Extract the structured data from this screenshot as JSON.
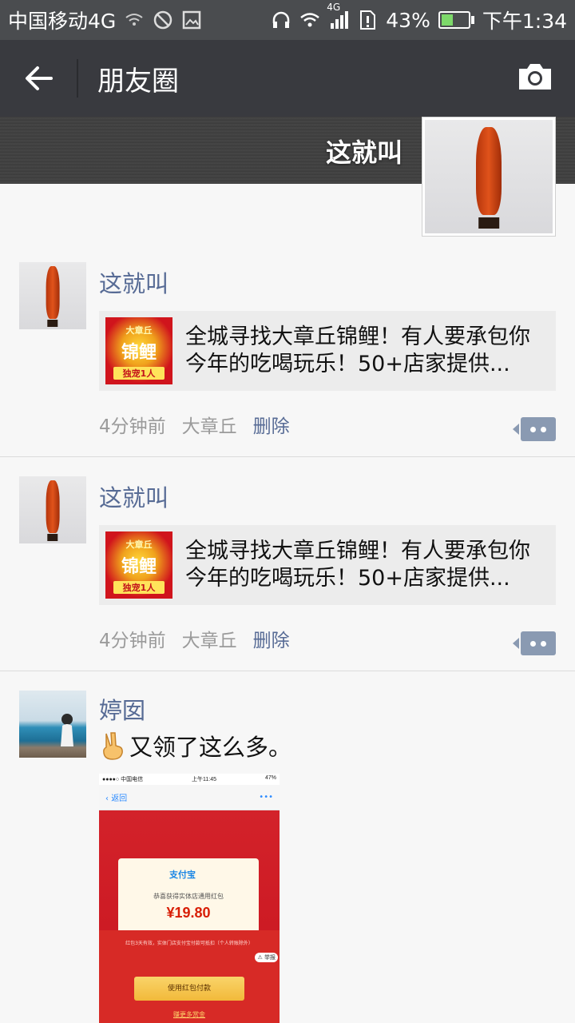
{
  "status_bar": {
    "carrier": "中国移动4G",
    "network_badge": "4G",
    "battery": "43%",
    "battery_level": 0.43,
    "time": "下午1:34"
  },
  "header": {
    "back_icon": "arrow-left-icon",
    "title": "朋友圈",
    "camera_icon": "camera-icon"
  },
  "cover": {
    "user_name": "这就叫"
  },
  "posts": [
    {
      "nickname": "这就叫",
      "link": {
        "thumb_top": "大章丘",
        "thumb_main": "锦鲤",
        "thumb_bottom": "独宠1人",
        "title": "全城寻找大章丘锦鲤！有人要承包你今年的吃喝玩乐！50+店家提供..."
      },
      "time": "4分钟前",
      "location": "大章丘",
      "delete": "删除"
    },
    {
      "nickname": "这就叫",
      "link": {
        "thumb_top": "大章丘",
        "thumb_main": "锦鲤",
        "thumb_bottom": "独宠1人",
        "title": "全城寻找大章丘锦鲤！有人要承包你今年的吃喝玩乐！50+店家提供..."
      },
      "time": "4分钟前",
      "location": "大章丘",
      "delete": "删除"
    },
    {
      "nickname": "婷囡",
      "text": "又领了这么多。",
      "image": {
        "status_carrier": "●●●●○ 中国电信",
        "status_time": "上午11:45",
        "status_battery": "47%",
        "nav_back": "返回",
        "nav_more": "•••",
        "logo": "支付宝",
        "subtitle": "恭喜获得实体店通用红包",
        "amount": "¥19.80",
        "note": "红包3天有效，实体门店支付宝付款可抵扣（个人转账除外）",
        "report": "举报",
        "button": "使用红包付款",
        "more_link": "赚更多赏金"
      }
    }
  ],
  "colors": {
    "title_bar": "#393a3f",
    "status_bar": "#4a4c4f",
    "nickname": "#576b95",
    "background": "#f7f7f7"
  }
}
